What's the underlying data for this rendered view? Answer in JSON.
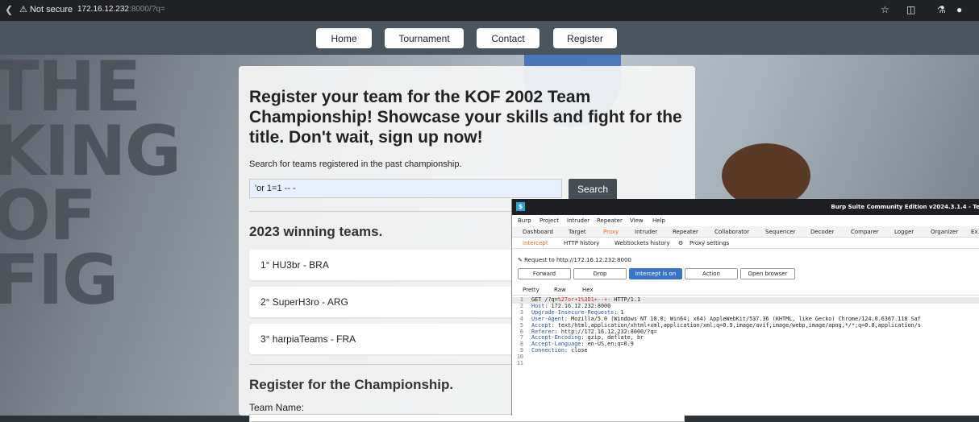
{
  "browser": {
    "security_label": "Not secure",
    "url_host": "172.16.12.232",
    "url_rest": ":8000/?q="
  },
  "nav": {
    "items": [
      "Home",
      "Tournament",
      "Contact",
      "Register"
    ]
  },
  "main": {
    "heading": "Register your team for the KOF 2002 Team Championship! Showcase your skills and fight for the title. Don't wait, sign up now!",
    "search_caption": "Search for teams registered in the past championship.",
    "search_value": "'or 1=1 -- -",
    "search_button": "Search",
    "winners_heading": "2023 winning teams.",
    "winners": [
      "1° HU3br - BRA",
      "2° SuperH3ro - ARG",
      "3° harpiaTeams - FRA"
    ],
    "register_heading": "Register for the Championship.",
    "team_name_label": "Team Name:"
  },
  "burp": {
    "title": "Burp Suite Community Edition v2024.3.1.4 - Te",
    "menu": [
      "Burp",
      "Project",
      "Intruder",
      "Repeater",
      "View",
      "Help"
    ],
    "tabs": [
      "Dashboard",
      "Target",
      "Proxy",
      "Intruder",
      "Repeater",
      "Collaborator",
      "Sequencer",
      "Decoder",
      "Comparer",
      "Logger",
      "Organizer",
      "Ex"
    ],
    "subtabs": [
      "Intercept",
      "HTTP history",
      "WebSockets history",
      "Proxy settings"
    ],
    "request_to": "Request to http://172.16.12.232:8000",
    "buttons": [
      "Forward",
      "Drop",
      "Intercept is on",
      "Action",
      "Open browser"
    ],
    "view_tabs": [
      "Pretty",
      "Raw",
      "Hex"
    ],
    "line_numbers": [
      "1",
      "2",
      "3",
      "4",
      "5",
      "6",
      "7",
      "8",
      "9",
      "10",
      "11"
    ],
    "request_lines": [
      {
        "key": "GET /?q=",
        "val": "%27or+1%3D1+--+-",
        "rest": " HTTP/1.1"
      },
      {
        "key": "Host",
        "val": ": 172.16.12.232:8000",
        "rest": ""
      },
      {
        "key": "Upgrade-Insecure-Requests",
        "val": ": 1",
        "rest": ""
      },
      {
        "key": "User-Agent",
        "val": ": Mozilla/5.0 (Windows NT 10.0; Win64; x64) AppleWebKit/537.36 (KHTML, like Gecko) Chrome/124.0.6367.118 Saf",
        "rest": ""
      },
      {
        "key": "Accept",
        "val": ": text/html,application/xhtml+xml,application/xml;q=0.9,image/avif,image/webp,image/apng,*/*;q=0.8,application/s",
        "rest": ""
      },
      {
        "key": "Referer",
        "val": ": http://172.16.12.232:8000/?q=",
        "rest": ""
      },
      {
        "key": "Accept-Encoding",
        "val": ": gzip, deflate, br",
        "rest": ""
      },
      {
        "key": "Accept-Language",
        "val": ": en-US,en;q=0.9",
        "rest": ""
      },
      {
        "key": "Connection",
        "val": ": close",
        "rest": ""
      }
    ]
  },
  "icons": [
    "back-arrow-icon",
    "warning-icon",
    "star-icon",
    "extensions-icon",
    "lab-icon",
    "profile-icon",
    "pencil-icon",
    "gear-icon",
    "burp-logo-icon"
  ]
}
